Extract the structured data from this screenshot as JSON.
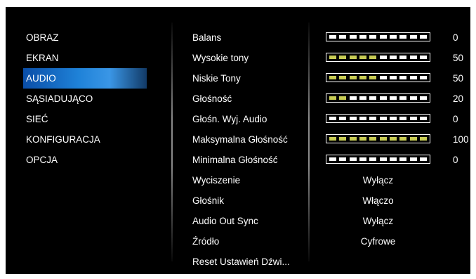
{
  "menu": {
    "items": [
      {
        "label": "OBRAZ"
      },
      {
        "label": "EKRAN"
      },
      {
        "label": "AUDIO",
        "active": true
      },
      {
        "label": "SĄSIADUJĄCO"
      },
      {
        "label": "SIEĆ"
      },
      {
        "label": "KONFIGURACJA"
      },
      {
        "label": "OPCJA"
      }
    ]
  },
  "audio": {
    "settings": [
      {
        "label": "Balans",
        "type": "slider",
        "value": "0",
        "level": 0
      },
      {
        "label": "Wysokie tony",
        "type": "slider",
        "value": "50",
        "level": 0.5
      },
      {
        "label": "Niskie Tony",
        "type": "slider",
        "value": "50",
        "level": 0.5
      },
      {
        "label": "Głośność",
        "type": "slider",
        "value": "20",
        "level": 0.2
      },
      {
        "label": "Głośn. Wyj. Audio",
        "type": "slider",
        "value": "0",
        "level": 0
      },
      {
        "label": "Maksymalna Głośność",
        "type": "slider",
        "value": "100",
        "level": 1.0
      },
      {
        "label": "Minimalna Głośność",
        "type": "slider",
        "value": "0",
        "level": 0
      },
      {
        "label": "Wyciszenie",
        "type": "option",
        "value": "Wyłącz"
      },
      {
        "label": "Głośnik",
        "type": "option",
        "value": "Włączo"
      },
      {
        "label": "Audio Out Sync",
        "type": "option",
        "value": "Wyłącz"
      },
      {
        "label": "Źródło",
        "type": "option",
        "value": "Cyfrowe"
      },
      {
        "label": "Reset Ustawień Dźwi...",
        "type": "action",
        "value": ""
      }
    ]
  },
  "colors": {
    "background": "#000000",
    "selection": "#1f82d8",
    "slider_on": "#c8cc55",
    "slider_off": "#ffffff"
  }
}
